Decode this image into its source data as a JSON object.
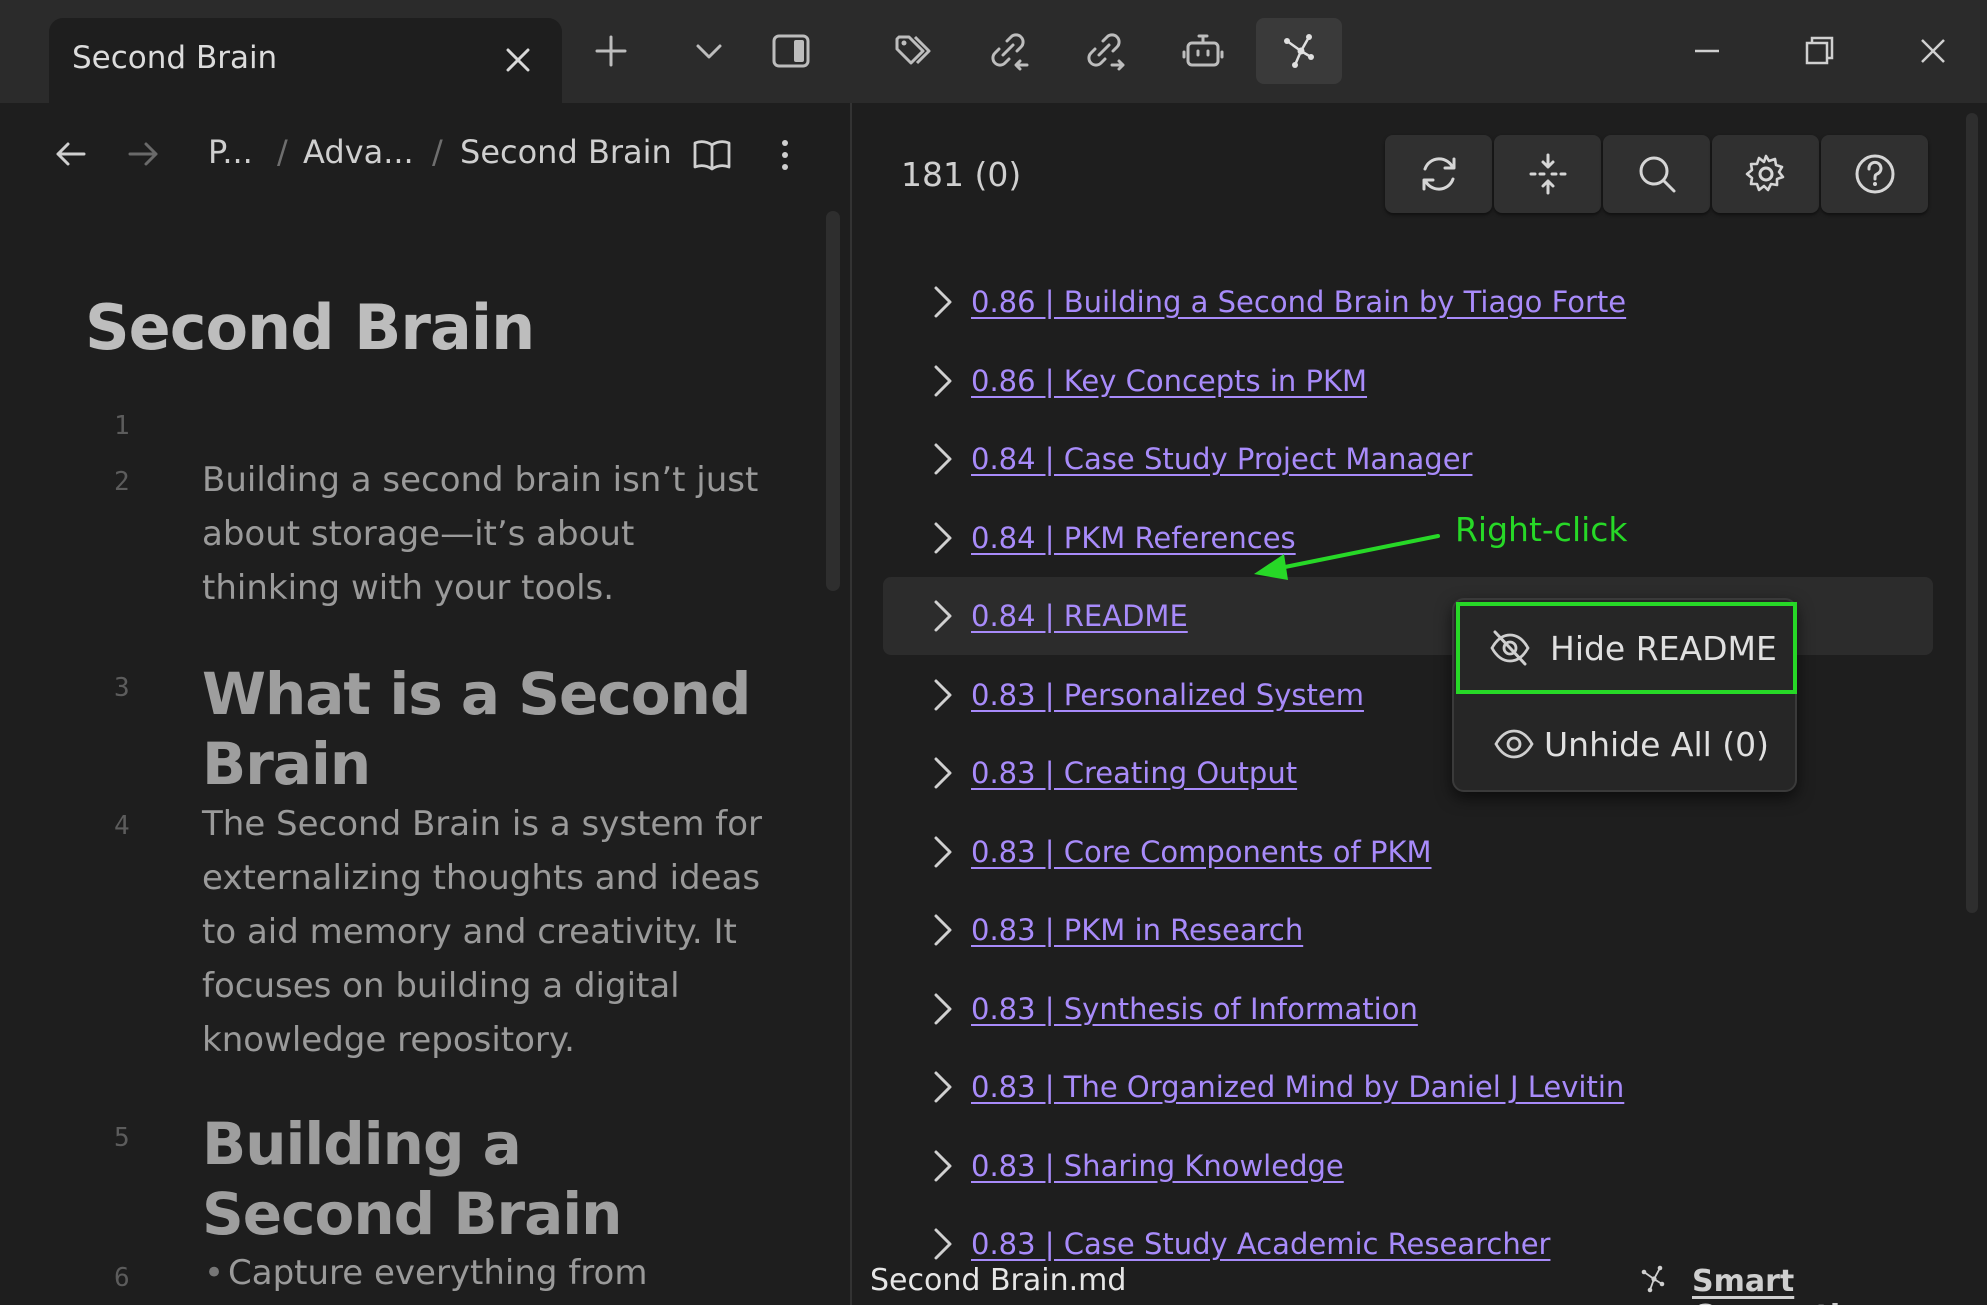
{
  "tab": {
    "title": "Second Brain"
  },
  "breadcrumb": [
    "P...",
    "Adva...",
    "Second Brain"
  ],
  "breadcrumb_sep": "/",
  "editor": {
    "title": "Second Brain",
    "lines": [
      {
        "num": "1"
      },
      {
        "num": "2",
        "text": "Building a second brain isn’t just about storage—it’s about thinking with your tools."
      },
      {
        "num": "3",
        "text": "What is a Second Brain"
      },
      {
        "num": "4",
        "text": "The Second Brain is a system for externalizing thoughts and ideas to aid memory and creativity. It focuses on building a digital knowledge repository."
      },
      {
        "num": "5",
        "text": "Building a Second Brain"
      },
      {
        "num": "6",
        "text": "Capture everything from"
      }
    ]
  },
  "connections": {
    "count": "181 (0)",
    "items": [
      "0.86 | Building a Second Brain by Tiago Forte",
      "0.86 | Key Concepts in PKM",
      "0.84 | Case Study Project Manager",
      "0.84 | PKM References",
      "0.84 | README",
      "0.83 | Personalized System",
      "0.83 | Creating Output",
      "0.83 | Core Components of PKM",
      "0.83 | PKM in Research",
      "0.83 | Synthesis of Information",
      "0.83 | The Organized Mind by Daniel J Levitin",
      "0.83 | Sharing Knowledge",
      "0.83 | Case Study Academic Researcher"
    ]
  },
  "annotation": {
    "text": "Right-click"
  },
  "context_menu": {
    "hide_label": "Hide README",
    "unhide_label": "Unhide All (0)"
  },
  "status": {
    "file": "Second Brain.md",
    "plugin": "Smart Connections"
  },
  "colors": {
    "link": "#a88bfa",
    "annotation": "#27d827",
    "background": "#1e1e1e"
  }
}
